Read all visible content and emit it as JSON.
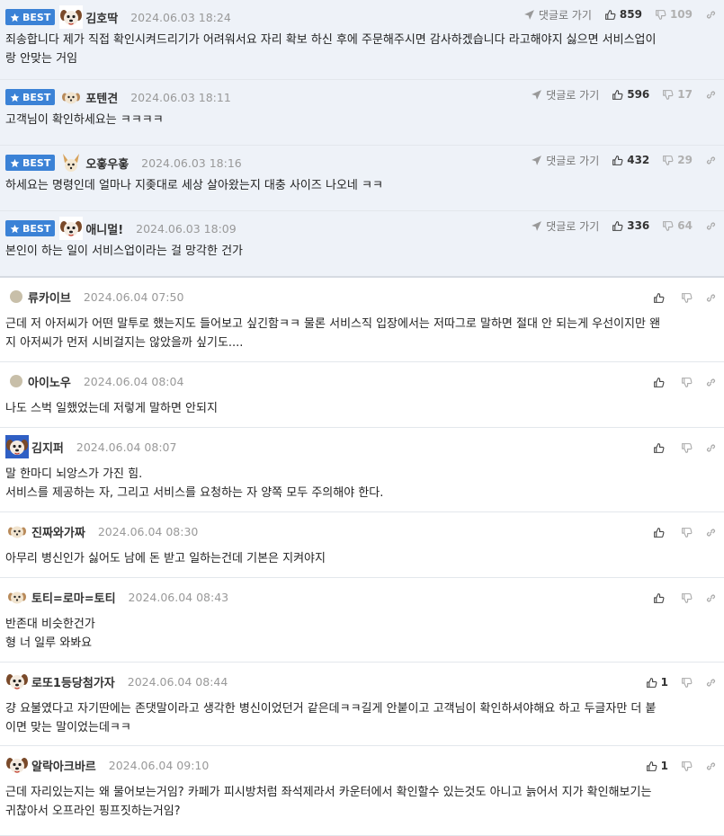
{
  "goto_label": "댓글로 가기",
  "best_label": "BEST",
  "colors": {
    "accent": "#3b82d6",
    "best_bg": "#eef2f8",
    "meta": "#999999"
  },
  "best_comments": [
    {
      "avatar": "dog-avatar",
      "nick": "김호딱",
      "date": "2024.06.03 18:24",
      "up": "859",
      "down": "109",
      "text": [
        "죄송합니다 제가 직접 확인시켜드리기가 어려워서요 자리 확보 하신 후에 주문해주시면 감사하겠습니다 라고해야지 싫으면 서비스업이",
        "랑 안맞는 거임"
      ]
    },
    {
      "avatar": "small-dog-avatar",
      "nick": "포텐견",
      "date": "2024.06.03 18:11",
      "up": "596",
      "down": "17",
      "text": [
        "고객님이 확인하세요는 ㅋㅋㅋㅋ"
      ]
    },
    {
      "avatar": "chihuahua-avatar",
      "nick": "오홓우홓",
      "date": "2024.06.03 18:16",
      "up": "432",
      "down": "29",
      "text": [
        "하세요는 명령인데 얼마나 지좆대로 세상 살아왔는지 대충 사이즈 나오네 ㅋㅋ"
      ]
    },
    {
      "avatar": "dog-avatar",
      "nick": "애니멀!",
      "date": "2024.06.03 18:09",
      "up": "336",
      "down": "64",
      "text": [
        "본인이 하는 일이 서비스업이라는 걸 망각한 건가"
      ]
    }
  ],
  "comments": [
    {
      "avatar": "dot-avatar",
      "nick": "류카이브",
      "date": "2024.06.04 07:50",
      "up": "",
      "text": [
        "근데 저 아저씨가 어떤 말투로 했는지도 들어보고 싶긴함ㅋㅋ 물론 서비스직 입장에서는 저따그로 말하면 절대 안 되는게 우선이지만 왠",
        "지 아저씨가 먼저 시비걸지는 않았을까 싶기도...."
      ]
    },
    {
      "avatar": "dot-avatar",
      "nick": "아이노우",
      "date": "2024.06.04 08:04",
      "up": "",
      "text": [
        "나도 스벅 일했었는데 저렇게 말하면 안되지"
      ]
    },
    {
      "avatar": "blue-dog-avatar",
      "nick": "김지퍼",
      "date": "2024.06.04 08:07",
      "up": "",
      "text": [
        "말 한마디 뇌앙스가 가진 힘.",
        "서비스를 제공하는 자, 그리고 서비스를 요청하는 자 양쪽 모두 주의해야 한다."
      ]
    },
    {
      "avatar": "small-dog-avatar",
      "nick": "진짜와가짜",
      "date": "2024.06.04 08:30",
      "up": "",
      "text": [
        "아무리 병신인가 싫어도 남에 돈 받고 일하는건데 기본은 지켜야지"
      ]
    },
    {
      "avatar": "small-dog-avatar",
      "nick": "토티=로마=토티",
      "date": "2024.06.04 08:43",
      "up": "",
      "text": [
        "반존대 비슷한건가",
        "형 너 일루 와봐요"
      ]
    },
    {
      "avatar": "dog-avatar",
      "nick": "로또1등당첨가자",
      "date": "2024.06.04 08:44",
      "up": "1",
      "text": [
        "걍 요불였다고 자기딴에는 존댓말이라고 생각한 병신이었던거 같은데ㅋㅋ길게 안붙이고 고객님이 확인하셔야해요 하고 두글자만 더 붙",
        "이면 맞는 말이었는데ㅋㅋ"
      ]
    },
    {
      "avatar": "dog-avatar",
      "nick": "알락아크바르",
      "date": "2024.06.04 09:10",
      "up": "1",
      "text": [
        "근데 자리있는지는 왜 물어보는거임? 카페가 피시방처럼 좌석제라서 카운터에서 확인할수 있는것도 아니고 늙어서 지가 확인해보기는",
        "귀찮아서 오프라인 핑프짓하는거임?"
      ]
    }
  ]
}
